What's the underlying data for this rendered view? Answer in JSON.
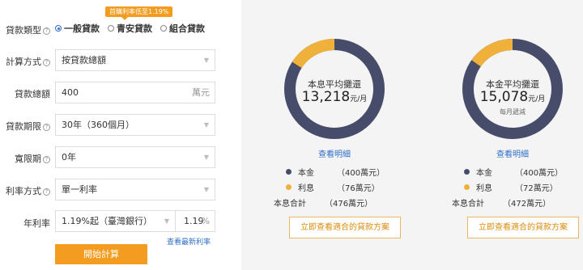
{
  "form": {
    "loan_type": {
      "label": "貸款類型",
      "promo": "首購利率低至1.19%",
      "options": [
        {
          "label": "一般貸款",
          "selected": true
        },
        {
          "label": "青安貸款",
          "selected": false
        },
        {
          "label": "組合貸款",
          "selected": false
        }
      ]
    },
    "calc_method": {
      "label": "計算方式",
      "value": "按貸款總額"
    },
    "amount": {
      "label": "貸款總額",
      "value": "400",
      "unit": "萬元"
    },
    "term": {
      "label": "貸款期限",
      "value": "30年（360個月）"
    },
    "grace": {
      "label": "寬限期",
      "value": "0年"
    },
    "rate_type": {
      "label": "利率方式",
      "value": "單一利率"
    },
    "annual_rate": {
      "label": "年利率",
      "preset": "1.19%起（臺灣銀行）",
      "value": "1.19",
      "unit": "%"
    },
    "latest_rate_link": "查看最新利率",
    "calculate_button": "開始計算"
  },
  "results": [
    {
      "title": "本息平均攤還",
      "amount": "13,218",
      "unit": "元/月",
      "subtitle": "",
      "detail_link": "查看明細",
      "principal_fraction": 0.84,
      "legend": [
        {
          "label": "本金",
          "value": "（400萬元）",
          "color": "#474c6b"
        },
        {
          "label": "利息",
          "value": "（76萬元）",
          "color": "#f0b13a"
        },
        {
          "label": "本息合計",
          "value": "（476萬元）"
        }
      ],
      "plan_button": "立即查看適合的貸款方案"
    },
    {
      "title": "本金平均攤還",
      "amount": "15,078",
      "unit": "元/月",
      "subtitle": "每月遞減",
      "detail_link": "查看明細",
      "principal_fraction": 0.847,
      "legend": [
        {
          "label": "本金",
          "value": "（400萬元）",
          "color": "#474c6b"
        },
        {
          "label": "利息",
          "value": "（72萬元）",
          "color": "#f0b13a"
        },
        {
          "label": "本息合計",
          "value": "（472萬元）"
        }
      ],
      "plan_button": "立即查看適合的貸款方案"
    }
  ],
  "colors": {
    "principal": "#474c6b",
    "interest": "#f0b13a",
    "accent": "#f39c1f",
    "link": "#2d6ec9"
  }
}
